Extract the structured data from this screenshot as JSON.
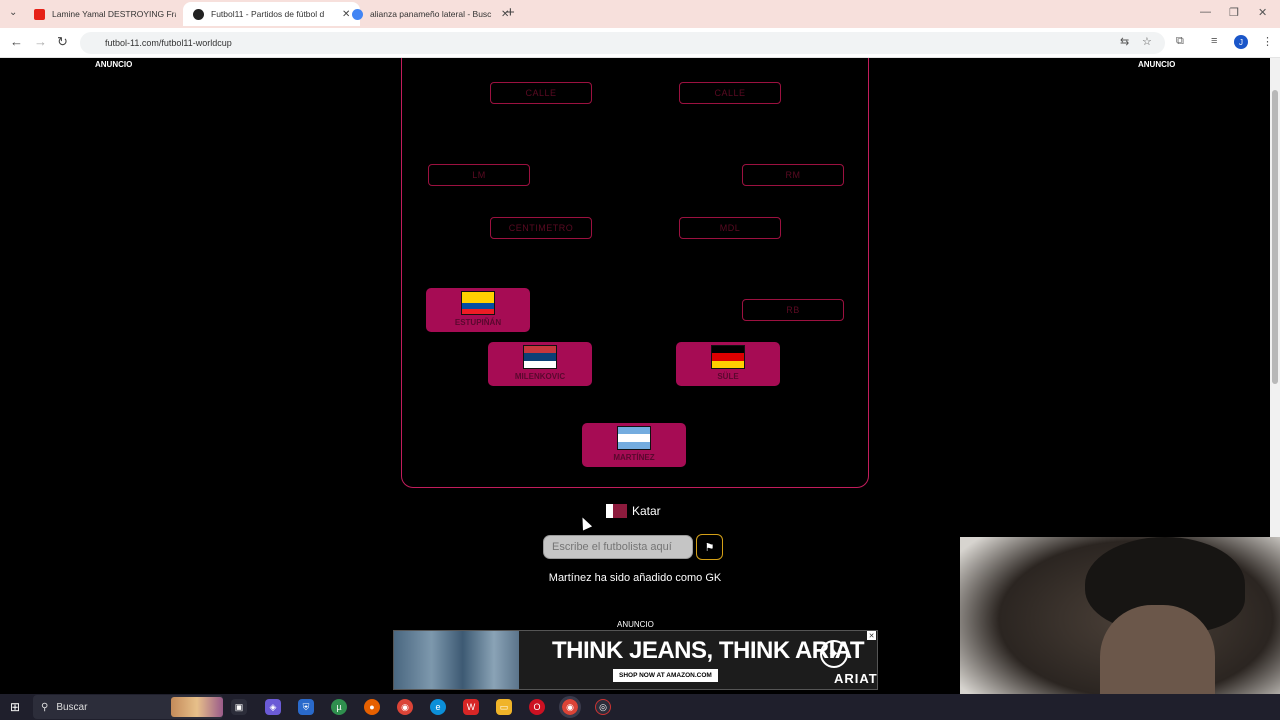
{
  "browser": {
    "tabs": [
      {
        "title": "Lamine Yamal DESTROYING Fra",
        "favicon_color": "#e62117",
        "active": false
      },
      {
        "title": "Futbol11 - Partidos de fútbol d",
        "favicon_color": "#222222",
        "active": true
      },
      {
        "title": "alianza panameño lateral - Busc",
        "favicon_color": "#4285f4",
        "active": false
      }
    ],
    "url": "futbol-11.com/futbol11-worldcup",
    "avatar_letter": "J"
  },
  "ads": {
    "label": "ANUNCIO",
    "banner_headline": "THINK JEANS, THINK ARIAT",
    "banner_cta": "SHOP NOW AT AMAZON.COM",
    "banner_brand": "ARIAT"
  },
  "pitch": {
    "empty_slots": {
      "lw": "CALLE",
      "rw": "CALLE",
      "lm": "LM",
      "rm": "RM",
      "cm": "CENTIMETRO",
      "mdl": "MDL",
      "rb": "RB"
    },
    "players": {
      "lb": {
        "name": "ESTUPIÑÁN",
        "flag": [
          "#ffd100",
          "#ffd100",
          "#034ea2",
          "#ed1c24"
        ]
      },
      "cb1": {
        "name": "MILENKOVIC",
        "flag": [
          "#c6363c",
          "#0c4076",
          "#ffffff"
        ]
      },
      "cb2": {
        "name": "SÜLE",
        "flag": [
          "#000000",
          "#dd0000",
          "#ffce00"
        ]
      },
      "gk": {
        "name": "MARTÍNEZ",
        "flag": [
          "#74acdf",
          "#ffffff",
          "#74acdf"
        ]
      }
    }
  },
  "game": {
    "country": "Katar",
    "input_placeholder": "Escribe el futbolista aquí",
    "message": "Martínez ha sido añadido como GK"
  },
  "taskbar": {
    "search_label": "Buscar"
  }
}
